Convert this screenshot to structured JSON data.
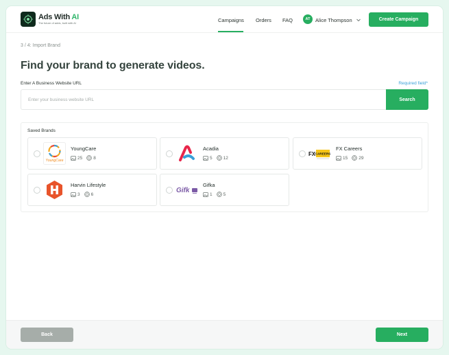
{
  "app": {
    "logo_prefix": "Ads With ",
    "logo_suffix": "AI",
    "tagline": "The future of adds, built with AI"
  },
  "nav": {
    "campaigns": "Campaigns",
    "orders": "Orders",
    "faq": "FAQ"
  },
  "user": {
    "initials": "AT",
    "name": "Alice Thompson"
  },
  "header": {
    "create_label": "Create Campaign"
  },
  "breadcrumb": "3 / 4:  Import Brand",
  "title": "Find your brand to generate videos.",
  "url_field": {
    "label": "Enter A Business Website URL",
    "required": "Required field*",
    "placeholder": "Enter your business website URL",
    "value": ""
  },
  "search_label": "Search",
  "saved": {
    "title": "Saved Brands",
    "brands": [
      {
        "name": "YoungCare",
        "images": "25",
        "videos": "8",
        "logo": "youngcare-logo"
      },
      {
        "name": "Acadia",
        "images": "5",
        "videos": "12",
        "logo": "acadia-logo"
      },
      {
        "name": "FX Careers",
        "images": "15",
        "videos": "29",
        "logo": "fx-careers-logo"
      },
      {
        "name": "Harvin Lifestyle",
        "images": "3",
        "videos": "6",
        "logo": "harvin-logo"
      },
      {
        "name": "Gifka",
        "images": "1",
        "videos": "5",
        "logo": "gifka-logo"
      }
    ]
  },
  "footer": {
    "back_label": "Back",
    "next_label": "Next"
  },
  "colors": {
    "accent": "#27ae60",
    "disabled": "#a6ada9",
    "link": "#3aa0d8"
  }
}
